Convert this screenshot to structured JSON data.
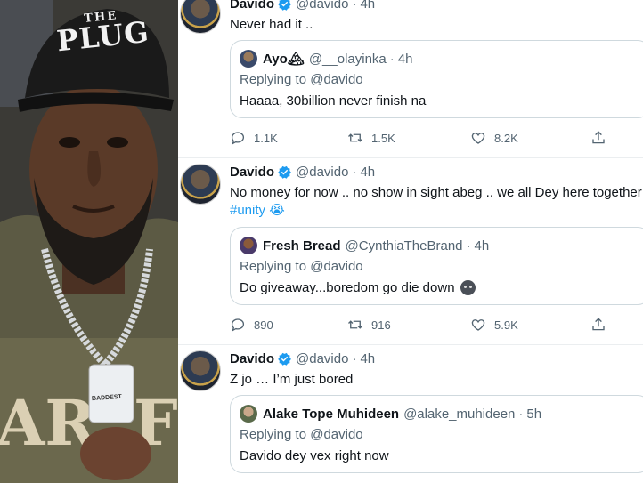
{
  "photo": {
    "cap_line1": "THE",
    "cap_line2": "PLUG",
    "pendant_text": "BADDEST"
  },
  "tweets": [
    {
      "author": "Davido",
      "handle": "@davido",
      "time": "4h",
      "text": "Never had it ..",
      "hashtag": "",
      "quote": {
        "author": "Ayo🏔",
        "handle": "@__olayinka",
        "time": "4h",
        "replying_prefix": "Replying to",
        "replying_to": "@davido",
        "text": "Haaaa, 30billion never finish na"
      },
      "actions": {
        "replies": "1.1K",
        "retweets": "1.5K",
        "likes": "8.2K"
      }
    },
    {
      "author": "Davido",
      "handle": "@davido",
      "time": "4h",
      "text": "No money for now .. no show in sight abeg .. we all Dey here together",
      "hashtag": "#unity 😭",
      "quote": {
        "author": "Fresh Bread",
        "handle": "@CynthiaTheBrand",
        "time": "4h",
        "replying_prefix": "Replying to",
        "replying_to": "@davido",
        "text": "Do giveaway...boredom go die down"
      },
      "actions": {
        "replies": "890",
        "retweets": "916",
        "likes": "5.9K"
      }
    },
    {
      "author": "Davido",
      "handle": "@davido",
      "time": "4h",
      "text": "Z jo … I’m just bored",
      "hashtag": "",
      "quote": {
        "author": "Alake Tope Muhideen",
        "handle": "@alake_muhideen",
        "time": "5h",
        "replying_prefix": "Replying to",
        "replying_to": "@davido",
        "text": "Davido dey vex right now"
      }
    }
  ],
  "colors": {
    "verified": "#1d9bf0",
    "secondary_text": "#536471",
    "hashtag": "#1d9bf0",
    "border": "#cfd9de"
  },
  "icons": [
    "reply-icon",
    "retweet-icon",
    "like-icon",
    "share-icon",
    "verified-badge-icon"
  ]
}
